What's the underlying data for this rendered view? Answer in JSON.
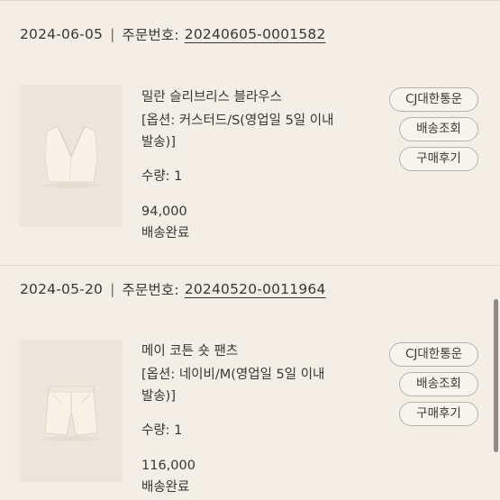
{
  "orders": [
    {
      "date": "2024-06-05",
      "order_label": "주문번호:",
      "order_number": "20240605-0001582",
      "product_name": "밀란 슬리브리스 블라우스",
      "option_line1": "[옵션: 커스터드/S(영업일 5일 이내",
      "option_line2": "발송)]",
      "quantity": "수량: 1",
      "price": "94,000",
      "status": "배송완료",
      "courier_button": "CJ대한통운",
      "track_button": "배송조회",
      "review_button": "구매후기",
      "thumbnail": "sleeveless-blouse-image"
    },
    {
      "date": "2024-05-20",
      "order_label": "주문번호:",
      "order_number": "20240520-0011964",
      "product_name": "메이 코튼 숏 팬츠",
      "option_line1": "[옵션: 네이비/M(영업일 5일 이내",
      "option_line2": "발송)]",
      "quantity": "수량: 1",
      "price": "116,000",
      "status": "배송완료",
      "courier_button": "CJ대한통운",
      "track_button": "배송조회",
      "review_button": "구매후기",
      "thumbnail": "short-pants-image"
    }
  ],
  "separator": "|",
  "colors": {
    "background": "#f3efe6",
    "text": "#3a3632",
    "divider": "#ddd6c9",
    "button_border": "#b9b2a8"
  }
}
